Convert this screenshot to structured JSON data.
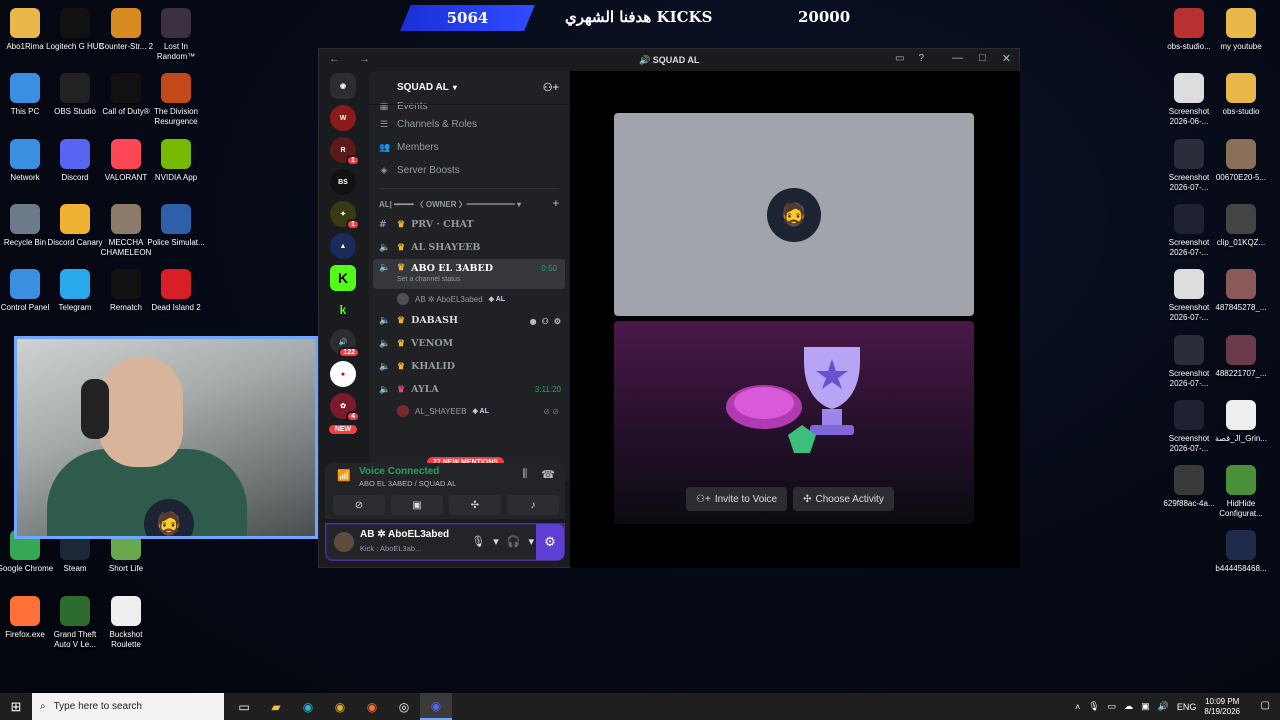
{
  "overlay": {
    "current": "5064",
    "title": "KICKS هدفنا الشهري",
    "target": "20000"
  },
  "desktop_left": [
    {
      "label": "Abo1Rima",
      "icon": "folder-icon",
      "color": "#e8b84a"
    },
    {
      "label": "Logitech G HUB",
      "icon": "logitech-icon",
      "color": "#111111"
    },
    {
      "label": "Counter-Str... 2",
      "icon": "cs2-icon",
      "color": "#d78a20"
    },
    {
      "label": "Lost In Random™",
      "icon": "game-icon",
      "color": "#3a3040"
    },
    {
      "label": "This PC",
      "icon": "pc-icon",
      "color": "#3b8fe0"
    },
    {
      "label": "OBS Studio",
      "icon": "obs-icon",
      "color": "#222222"
    },
    {
      "label": "Call of Duty®",
      "icon": "cod-icon",
      "color": "#111111"
    },
    {
      "label": "The Division Resurgence",
      "icon": "game-icon",
      "color": "#c24a1a"
    },
    {
      "label": "Network",
      "icon": "network-icon",
      "color": "#3b8fe0"
    },
    {
      "label": "Discord",
      "icon": "discord-icon",
      "color": "#5865f2"
    },
    {
      "label": "VALORANT",
      "icon": "valorant-icon",
      "color": "#ff4655"
    },
    {
      "label": "NVIDIA App",
      "icon": "nvidia-icon",
      "color": "#76b900"
    },
    {
      "label": "Recycle Bin",
      "icon": "recycle-icon",
      "color": "#6c7a89"
    },
    {
      "label": "Discord Canary",
      "icon": "discord-icon",
      "color": "#f0b232"
    },
    {
      "label": "MECCHA CHAMELEON",
      "icon": "game-icon",
      "color": "#8c7a6b"
    },
    {
      "label": "Police Simulat...",
      "icon": "game-icon",
      "color": "#2e5fa8"
    },
    {
      "label": "Control Panel",
      "icon": "control-panel-icon",
      "color": "#3b8fe0"
    },
    {
      "label": "Telegram",
      "icon": "telegram-icon",
      "color": "#29a9eb"
    },
    {
      "label": "Rematch",
      "icon": "game-icon",
      "color": "#111111"
    },
    {
      "label": "Dead Island 2",
      "icon": "game-icon",
      "color": "#d81f26"
    },
    {
      "label": "Google Chrome",
      "icon": "chrome-icon",
      "color": "#34a853"
    },
    {
      "label": "Steam",
      "icon": "steam-icon",
      "color": "#1b2838"
    },
    {
      "label": "Short Life",
      "icon": "game-icon",
      "color": "#6aa84f"
    },
    {
      "label": "Firefox.exe",
      "icon": "firefox-icon",
      "color": "#ff7139"
    },
    {
      "label": "Grand Theft Auto V Le...",
      "icon": "gta-icon",
      "color": "#2e6b2e"
    },
    {
      "label": "Buckshot Roulette",
      "icon": "file-icon",
      "color": "#eeeeee"
    }
  ],
  "desktop_right": [
    {
      "label": "obs-studio...",
      "icon": "archive-icon",
      "color": "#b83030"
    },
    {
      "label": "my youtube",
      "icon": "folder-icon",
      "color": "#e8b84a"
    },
    {
      "label": "Screenshot 2026-06-...",
      "icon": "image-icon",
      "color": "#dddddd"
    },
    {
      "label": "obs-studio",
      "icon": "folder-icon",
      "color": "#e8b84a"
    },
    {
      "label": "Screenshot 2026-07-...",
      "icon": "image-icon",
      "color": "#2a2d3a"
    },
    {
      "label": "00670E20-5...",
      "icon": "image-icon",
      "color": "#8a6f5a"
    },
    {
      "label": "Screenshot 2026-07-...",
      "icon": "image-icon",
      "color": "#1e2130"
    },
    {
      "label": "clip_01KQZ...",
      "icon": "video-icon",
      "color": "#444444"
    },
    {
      "label": "Screenshot 2026-07-...",
      "icon": "image-icon",
      "color": "#dddddd"
    },
    {
      "label": "487845278_...",
      "icon": "image-icon",
      "color": "#8a5a5a"
    },
    {
      "label": "Screenshot 2026-07-...",
      "icon": "image-icon",
      "color": "#2a2d3a"
    },
    {
      "label": "488221707_...",
      "icon": "image-icon",
      "color": "#6a3a4a"
    },
    {
      "label": "Screenshot 2026-07-...",
      "icon": "image-icon",
      "color": "#1e2130"
    },
    {
      "label": "قصة_JI_Grin...",
      "icon": "video-icon",
      "color": "#eeeeee"
    },
    {
      "label": "629f88ac-4a...",
      "icon": "image-icon",
      "color": "#3a3a3a"
    },
    {
      "label": "HidHide Configurat...",
      "icon": "app-icon",
      "color": "#4a8f3a"
    },
    {
      "label": "b444458468...",
      "icon": "image-icon",
      "color": "#1e2a4a"
    }
  ],
  "discord": {
    "window_title": "SQUAD AL",
    "server_name": "SQUAD AL",
    "menu": [
      {
        "label": "Events",
        "icon": "calendar-icon"
      },
      {
        "label": "Channels & Roles",
        "icon": "list-icon"
      },
      {
        "label": "Members",
        "icon": "members-icon"
      },
      {
        "label": "Server Boosts",
        "icon": "boost-icon"
      }
    ],
    "category_prefix": "AL|",
    "category": "━━━━ 〈 OWNER 〉━━━━━━",
    "channels": [
      {
        "name": "PRV · CHAT",
        "type": "text"
      },
      {
        "name": "AL SHAYEEB",
        "type": "voice"
      },
      {
        "name": "ABO EL 3ABED",
        "type": "voice",
        "active": true,
        "timer": "0:50",
        "sub": "Set a channel status"
      },
      {
        "name": "DABASH",
        "type": "voice",
        "hover": true
      },
      {
        "name": "VENOM",
        "type": "voice"
      },
      {
        "name": "KHALID",
        "type": "voice"
      },
      {
        "name": "AYLA",
        "type": "voice",
        "timer": "3:11:20"
      }
    ],
    "active_user": {
      "name": "AB ✲ AboEL3abed",
      "tag": "AL"
    },
    "ayla_user": {
      "name": "AL_SHAYEEB",
      "tag": "AL"
    },
    "mentions": "27 NEW MENTIONS",
    "voice_status": "Voice Connected",
    "voice_channel": "ABO EL 3ABED / SQUAD AL",
    "user": {
      "name": "AB ✲ AboEL3abed",
      "status": "Kick : AboEL3ab..."
    },
    "guild_badges": [
      "1",
      "1",
      "122",
      "4"
    ],
    "guild_new": "NEW",
    "actions": {
      "invite": "Invite to Voice",
      "activity": "Choose Activity"
    }
  },
  "taskbar": {
    "search_placeholder": "Type here to search",
    "lang": "ENG",
    "time": "10:09 PM",
    "date": "8/19/2026"
  }
}
